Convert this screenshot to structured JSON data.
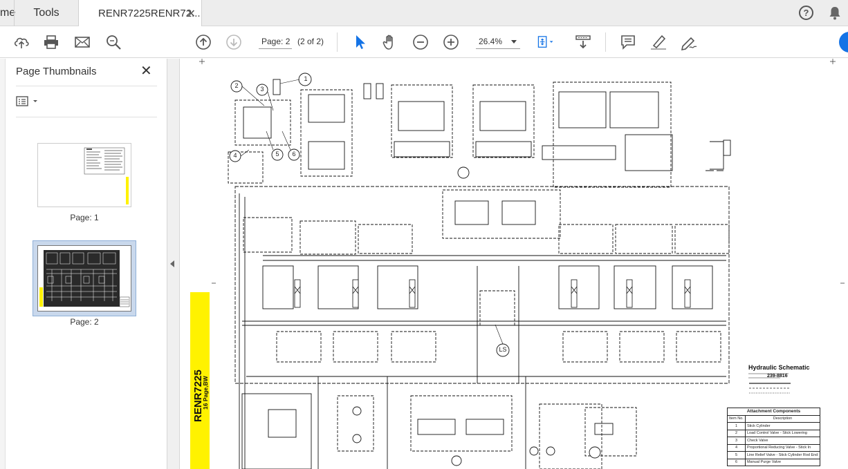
{
  "tabs": {
    "home_label": "me",
    "tools_label": "Tools",
    "document_label": "RENR7225RENR72...",
    "close_glyph": "✕"
  },
  "toolbar": {
    "page_label": "Page: 2",
    "page_count": "(2 of 2)",
    "zoom": "26.4%"
  },
  "sidepanel": {
    "title": "Page Thumbnails",
    "thumbnails": [
      {
        "label": "Page: 1"
      },
      {
        "label": "Page: 2"
      }
    ]
  },
  "document": {
    "doc_id": "RENR7225",
    "doc_pages": "16 Page,BW",
    "title": "Hydraulic Schematic",
    "part_number": "239-8816",
    "ls_label": "LS",
    "callouts": [
      "1",
      "2",
      "3",
      "4",
      "5",
      "6"
    ],
    "components_table": {
      "title": "Attachment Components",
      "headers": [
        "Item No.",
        "Description"
      ],
      "rows": [
        {
          "no": "1",
          "desc": "Stick Cylinder"
        },
        {
          "no": "2",
          "desc": "Load Control Valve - Stick Lowering"
        },
        {
          "no": "3",
          "desc": "Check Valve"
        },
        {
          "no": "4",
          "desc": "Proportional Reducing Valve - Stick In"
        },
        {
          "no": "5",
          "desc": "Line Relief Valve - Stick Cylinder Rod End"
        },
        {
          "no": "6",
          "desc": "Manual Purge Valve"
        }
      ]
    }
  },
  "colors": {
    "accent_blue": "#1473e6",
    "doc_strip_yellow": "#fff200",
    "selected_thumb": "#c9d8ec"
  },
  "icons": [
    "upload-cloud-icon",
    "print-icon",
    "email-icon",
    "search-icon",
    "previous-page-icon",
    "next-page-icon",
    "select-tool-icon",
    "hand-tool-icon",
    "zoom-out-icon",
    "zoom-in-icon",
    "fit-page-icon",
    "scroll-mode-icon",
    "comment-icon",
    "highlight-icon",
    "sign-icon",
    "help-icon",
    "bell-icon"
  ]
}
